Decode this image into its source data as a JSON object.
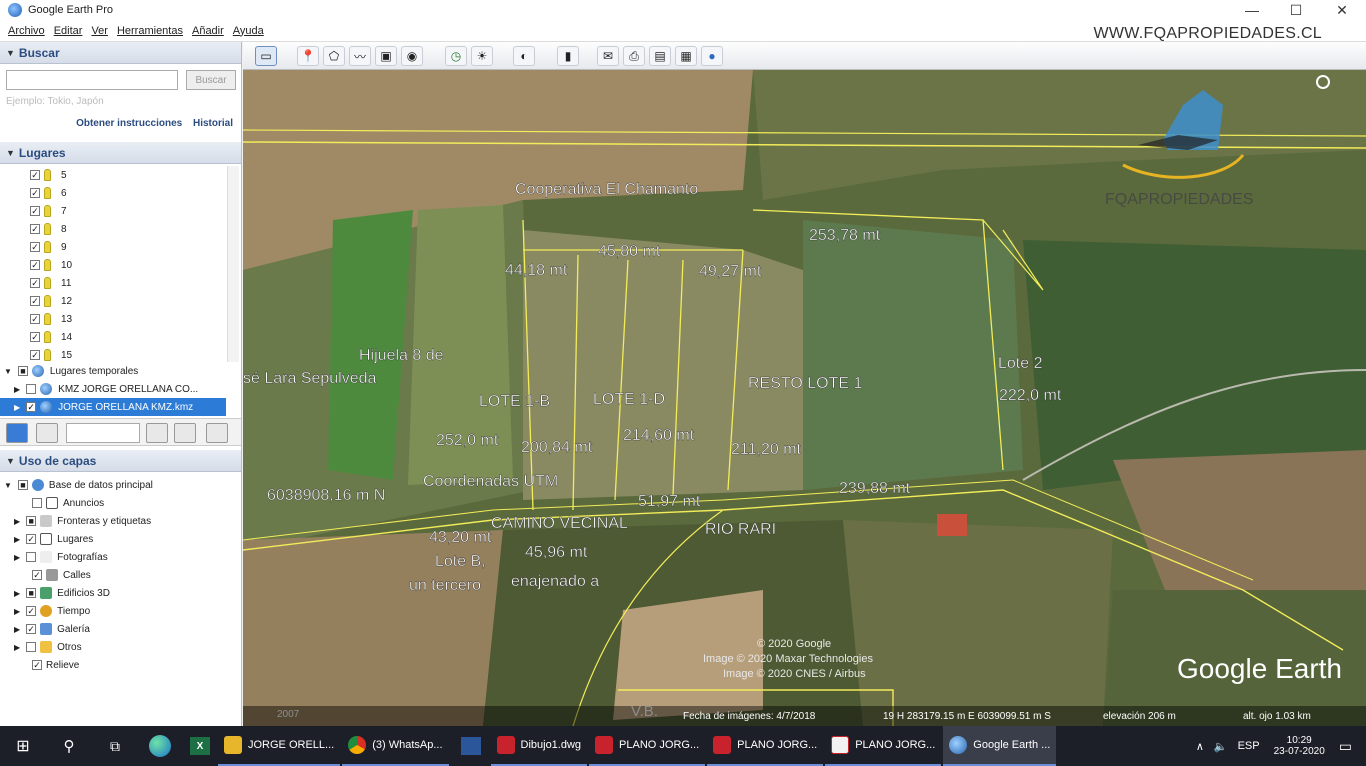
{
  "window": {
    "title": "Google Earth Pro",
    "minimize": "—",
    "maximize": "☐",
    "close": "✕"
  },
  "watermark_url": "WWW.FQAPROPIEDADES.CL",
  "watermark_brand": "FQAPROPIEDADES",
  "menu": [
    "Archivo",
    "Editar",
    "Ver",
    "Herramientas",
    "Añadir",
    "Ayuda"
  ],
  "search": {
    "header": "Buscar",
    "button": "Buscar",
    "hint": "Ejemplo: Tokio, Japón",
    "link_directions": "Obtener instrucciones",
    "link_history": "Historial"
  },
  "places": {
    "header": "Lugares",
    "items": [
      "5",
      "6",
      "7",
      "8",
      "9",
      "10",
      "11",
      "12",
      "13",
      "14",
      "15"
    ],
    "temp": "Lugares temporales",
    "kmz1": "KMZ JORGE ORELLANA CO...",
    "kmz2": "JORGE ORELLANA KMZ.kmz"
  },
  "layers": {
    "header": "Uso de capas",
    "items": [
      "Base de datos principal",
      "Anuncios",
      "Fronteras y etiquetas",
      "Lugares",
      "Fotografías",
      "Calles",
      "Edificios 3D",
      "Tiempo",
      "Galería",
      "Otros",
      "Relieve"
    ]
  },
  "map": {
    "labels": {
      "coop": "Cooperativa El Chamanto",
      "l1": "44,18 mt",
      "l2": "45,80 mt",
      "l3": "49,27 mt",
      "l4": "253,78 mt",
      "hijuela1": "Hijuela 8 de",
      "hijuela2": "sé Lara Sepulveda",
      "lote1b": "LOTE 1-B",
      "lote1d": "LOTE 1-D",
      "resto": "RESTO LOTE 1",
      "lote2": "Lote 2",
      "l5": "222,0 mt",
      "l6": "252,0 mt",
      "l7": "200,84 mt",
      "l8": "214,60 mt",
      "l9": "211,20 mt",
      "utm1": "6038908,16 m N",
      "utm2": "Coordenadas UTM",
      "l10": "51,97 mt",
      "l11": "239,88 mt",
      "camino": "CAMINO VECINAL",
      "rio": "RIO RARI",
      "l12": "43,20 mt",
      "l13": "45,96 mt",
      "loteb": "Lote B,",
      "tercero": "un tercero",
      "enajenado": "enajenado a",
      "copyright1": "© 2020 Google",
      "copyright2": "Image © 2020 Maxar Technologies",
      "copyright3": "Image © 2020 CNES / Airbus",
      "ge_logo": "Google Earth",
      "year": "2007",
      "vb": "V.B."
    },
    "status": {
      "date": "Fecha de imágenes: 4/7/2018",
      "coords": "19 H 283179.15 m E 6039099.51 m S",
      "elev": "elevación 206 m",
      "alt": "alt. ojo 1.03 km"
    }
  },
  "taskbar": {
    "apps": [
      "JORGE ORELL...",
      "(3) WhatsAp...",
      "Dibujo1.dwg",
      "PLANO JORG...",
      "PLANO JORG...",
      "PLANO JORG...",
      "Google Earth ..."
    ],
    "lang": "ESP",
    "time": "10:29",
    "date": "23-07-2020"
  },
  "colors": {
    "accent": "#2c7bd6",
    "boundary": "#f2ec5a",
    "taskbar": "#1d1f28"
  }
}
